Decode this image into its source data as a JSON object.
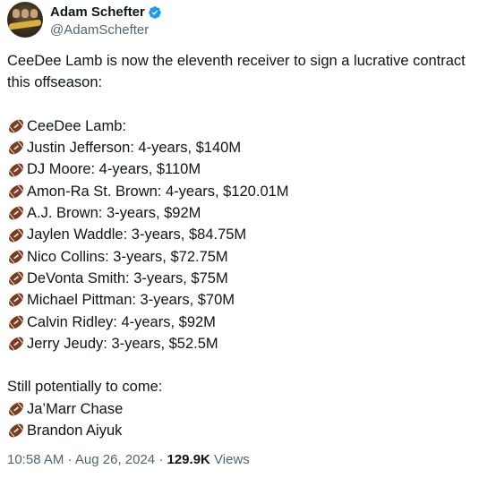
{
  "author": {
    "display_name": "Adam Schefter",
    "handle": "@AdamSchefter",
    "verified": true,
    "verified_color": "#1d9bf0"
  },
  "tweet": {
    "intro": "CeeDee Lamb is now the eleventh receiver to sign a lucrative contract this offseason:",
    "contracts": [
      "CeeDee Lamb:",
      "Justin Jefferson: 4-years, $140M",
      "DJ Moore: 4-years, $110M",
      "Amon-Ra St. Brown: 4-years, $120.01M",
      "A.J. Brown: 3-years, $92M",
      "Jaylen Waddle: 3-years, $84.75M",
      "Nico Collins: 3-years, $72.75M",
      "DeVonta Smith: 3-years, $75M",
      "Michael Pittman: 3-years, $70M",
      "Calvin Ridley: 4-years, $92M",
      "Jerry Jeudy: 3-years, $52.5M"
    ],
    "pending_heading": "Still potentially to come:",
    "pending": [
      "Ja’Marr Chase",
      "Brandon Aiyuk"
    ],
    "bullet_icon": "american-football-emoji"
  },
  "meta": {
    "time": "10:58 AM",
    "date": "Aug 26, 2024",
    "separator": "·",
    "views_count": "129.9K",
    "views_label": "Views"
  }
}
